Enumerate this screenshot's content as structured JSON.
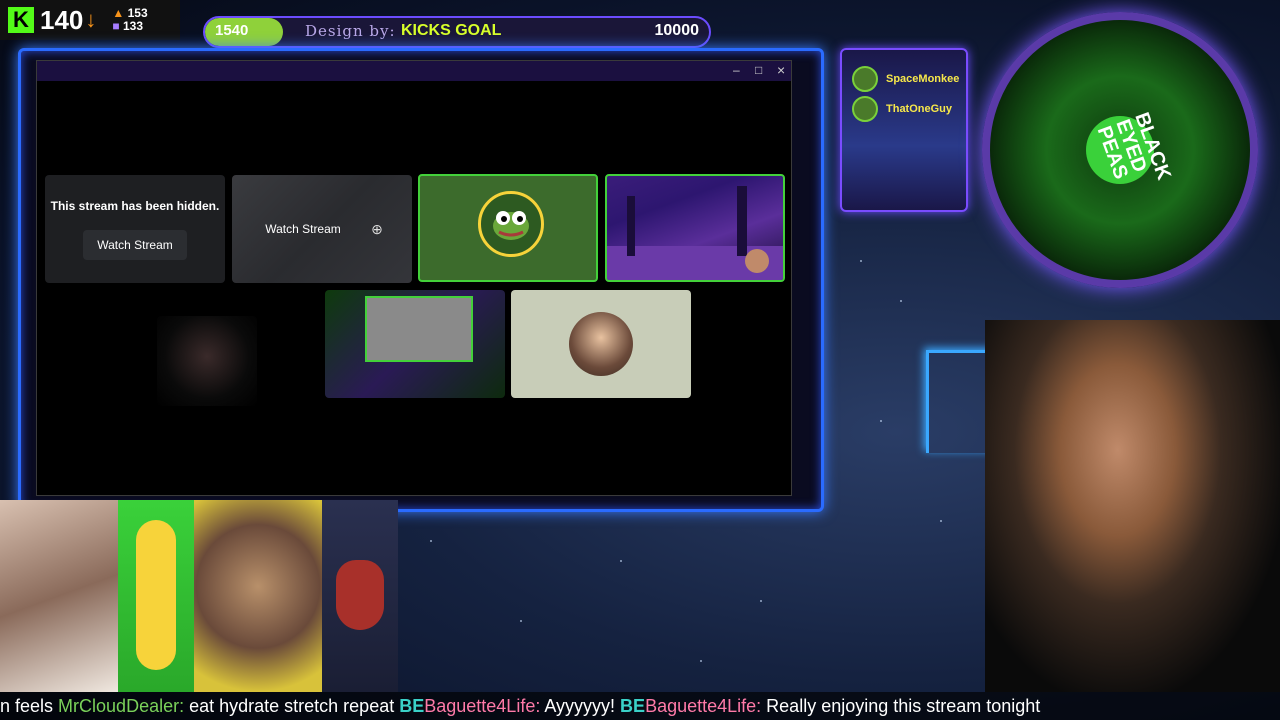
{
  "stats": {
    "viewer_count": "140",
    "stat_a": "153",
    "stat_b": "133"
  },
  "goal": {
    "current": "1540",
    "title": "Design by:",
    "label": "KICKS GOAL",
    "target": "10000",
    "progress": 0.154
  },
  "window": {
    "controls": [
      "–",
      "□",
      "×"
    ]
  },
  "tiles": {
    "hidden_message": "This stream has been hidden.",
    "watch_stream_1": "Watch Stream",
    "watch_stream_2": "Watch Stream"
  },
  "viewers": [
    {
      "name": "SpaceMonkee"
    },
    {
      "name": "ThatOneGuy"
    }
  ],
  "album": {
    "text": "BLACK EYED PEAS"
  },
  "ticker": [
    {
      "type": "msg",
      "text": "n feels "
    },
    {
      "type": "user",
      "text": "MrCloudDealer:"
    },
    {
      "type": "msg",
      "text": " eat hydrate stretch repeat "
    },
    {
      "type": "badge",
      "text": "BE"
    },
    {
      "type": "user2",
      "text": "Baguette4Life:"
    },
    {
      "type": "msg",
      "text": " Ayyyyyy! "
    },
    {
      "type": "badge",
      "text": "BE"
    },
    {
      "type": "user2",
      "text": "Baguette4Life:"
    },
    {
      "type": "msg",
      "text": " Really enjoying this stream tonight"
    }
  ],
  "colors": {
    "kick_green": "#53fc18",
    "frame_blue": "#2a6bff",
    "tile_border": "#43d13a"
  }
}
